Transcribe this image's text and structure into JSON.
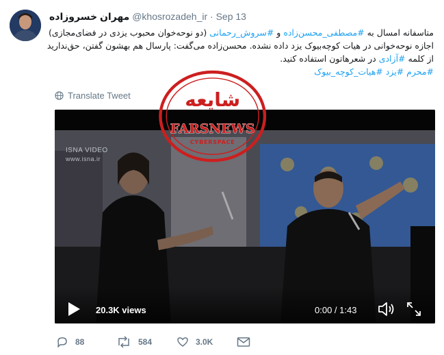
{
  "tweet": {
    "display_name": "مهران خسروزاده",
    "handle": "@khosrozadeh_ir",
    "separator": "·",
    "time": "Sep 13",
    "lines": [
      [
        {
          "t": "متاسفانه امسال به ",
          "link": false
        },
        {
          "t": "#مصطفی_محسن‌زاده",
          "link": true
        },
        {
          "t": " و ",
          "link": false
        },
        {
          "t": "#سروش_رحمانی",
          "link": true
        },
        {
          "t": " (دو نوحه‌خوان محبوب یزدی در فضای‌مجازی)",
          "link": false
        }
      ],
      [
        {
          "t": "اجازه نوحه‌خوانی در هیات کوچه‌بیوک یزد داده نشده. محسن‌زاده می‌گفت: پارسال هم بهشون گفتن، حق‌ندارید",
          "link": false
        }
      ],
      [
        {
          "t": "از کلمه ",
          "link": false
        },
        {
          "t": "#آزادی",
          "link": true
        },
        {
          "t": " در شعرهاتون استفاده کنید.",
          "link": false
        }
      ],
      [
        {
          "t": "#محرم #یزد #هیات_کوچه_بیوک",
          "link": true
        }
      ]
    ],
    "translate_label": "Translate Tweet"
  },
  "video": {
    "watermark_line1": "ISNA VIDEO",
    "watermark_line2": "www.isna.ir",
    "views": "20.3K views",
    "timecode": "0:00 / 1:43"
  },
  "stamp": {
    "main_text": "شایعه",
    "brand_text": "FARSNEWS",
    "sub_text": "CYBERSPACE",
    "color": "#cc1f1f"
  },
  "actions": {
    "replies": "88",
    "retweets": "584",
    "likes": "3.0K"
  },
  "colors": {
    "link": "#1da1f2",
    "muted": "#657786"
  }
}
